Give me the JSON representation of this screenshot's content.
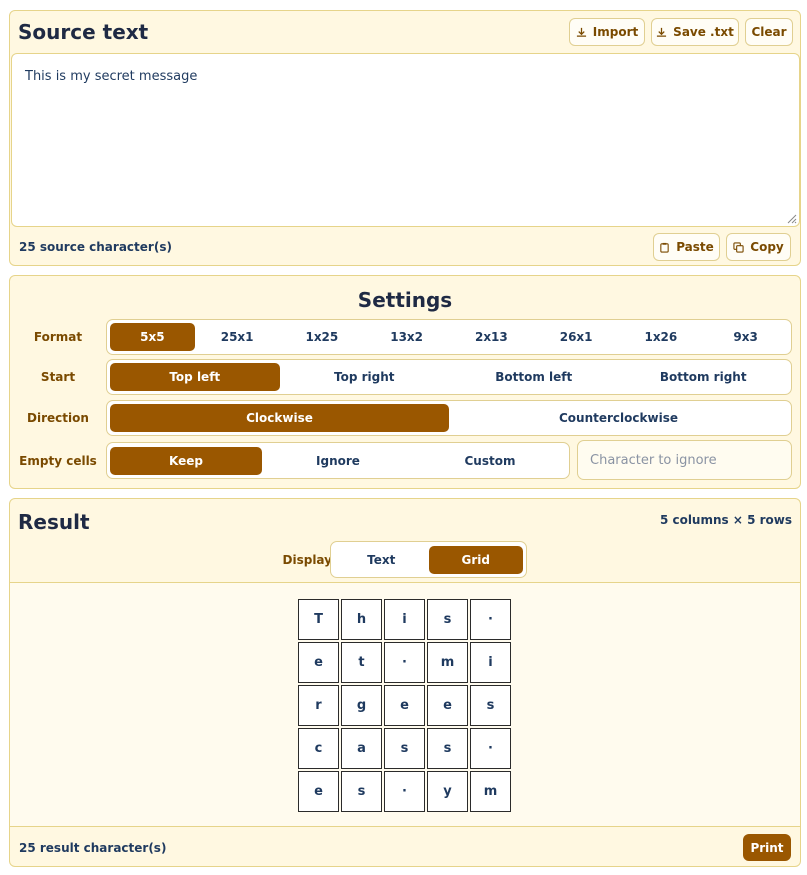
{
  "source": {
    "title": "Source text",
    "import_label": "Import",
    "save_label": "Save .txt",
    "clear_label": "Clear",
    "text": "This is my secret message",
    "count_label": "25 source character(s)",
    "paste_label": "Paste",
    "copy_label": "Copy"
  },
  "settings": {
    "title": "Settings",
    "format": {
      "label": "Format",
      "options": [
        "5x5",
        "25x1",
        "1x25",
        "13x2",
        "2x13",
        "26x1",
        "1x26",
        "9x3"
      ],
      "selected": "5x5"
    },
    "start": {
      "label": "Start",
      "options": [
        "Top left",
        "Top right",
        "Bottom left",
        "Bottom right"
      ],
      "selected": "Top left"
    },
    "direction": {
      "label": "Direction",
      "options": [
        "Clockwise",
        "Counterclockwise"
      ],
      "selected": "Clockwise"
    },
    "empty_cells": {
      "label": "Empty cells",
      "options": [
        "Keep",
        "Ignore",
        "Custom"
      ],
      "selected": "Keep",
      "placeholder": "Character to ignore"
    }
  },
  "result": {
    "title": "Result",
    "dimensions": "5 columns × 5 rows",
    "display_label": "Display",
    "display_options": [
      "Text",
      "Grid"
    ],
    "display_selected": "Grid",
    "grid": [
      [
        "T",
        "h",
        "i",
        "s",
        "·"
      ],
      [
        "e",
        "t",
        "·",
        "m",
        "i"
      ],
      [
        "r",
        "g",
        "e",
        "e",
        "s"
      ],
      [
        "c",
        "a",
        "s",
        "s",
        "·"
      ],
      [
        "e",
        "s",
        "·",
        "y",
        "m"
      ]
    ],
    "count_label": "25 result character(s)",
    "print_label": "Print"
  },
  "colors": {
    "accent": "#9a5700",
    "panel_bg": "#fff8e1",
    "border": "#e6d48a",
    "text": "#1f3a5f"
  }
}
